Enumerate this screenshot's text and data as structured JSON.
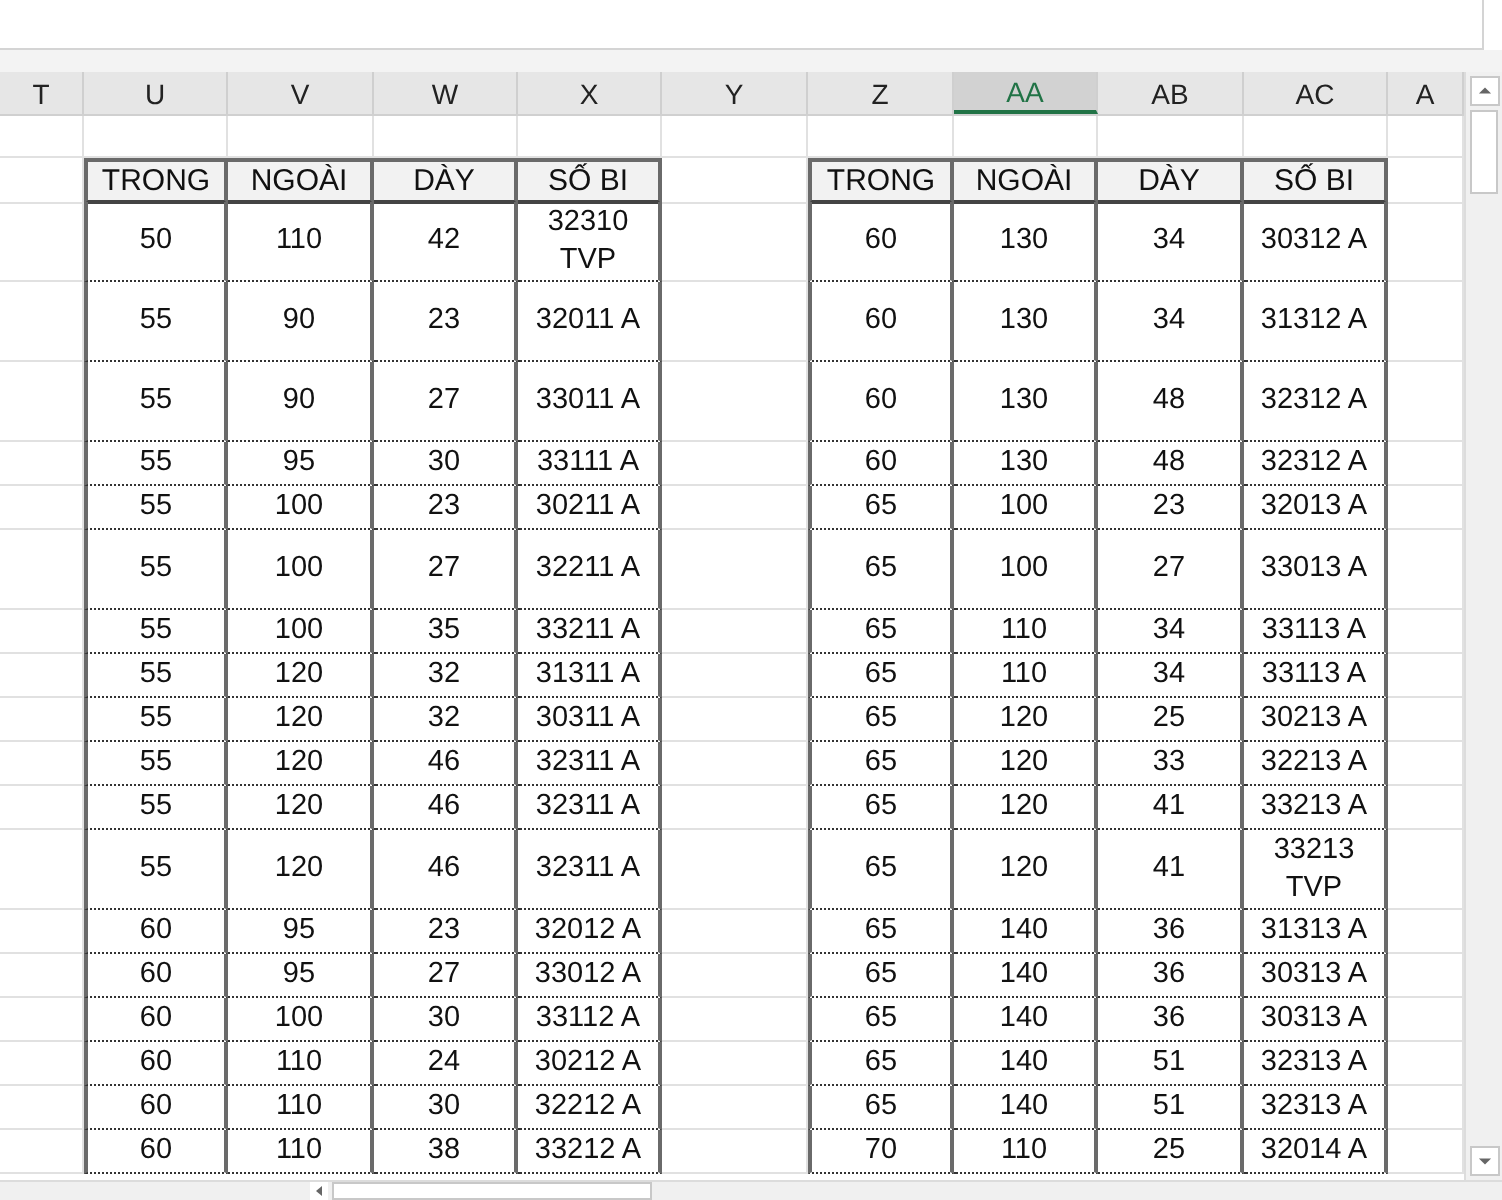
{
  "column_headers": [
    {
      "label": "T",
      "selected": false
    },
    {
      "label": "U",
      "selected": false
    },
    {
      "label": "V",
      "selected": false
    },
    {
      "label": "W",
      "selected": false
    },
    {
      "label": "X",
      "selected": false
    },
    {
      "label": "Y",
      "selected": false
    },
    {
      "label": "Z",
      "selected": false
    },
    {
      "label": "AA",
      "selected": true
    },
    {
      "label": "AB",
      "selected": false
    },
    {
      "label": "AC",
      "selected": false
    },
    {
      "label": "A",
      "selected": false
    }
  ],
  "tables": [
    {
      "columns": [
        "TRONG",
        "NGOÀI",
        "DÀY",
        "SỐ BI"
      ]
    },
    {
      "columns": [
        "TRONG",
        "NGOÀI",
        "DÀY",
        "SỐ BI"
      ]
    }
  ],
  "rows": [
    {
      "tall": true,
      "cells": [
        [
          "50",
          "110",
          "42",
          "32310 TVP"
        ],
        [
          "60",
          "130",
          "34",
          "30312 A"
        ]
      ]
    },
    {
      "tall": true,
      "cells": [
        [
          "55",
          "90",
          "23",
          "32011 A"
        ],
        [
          "60",
          "130",
          "34",
          "31312 A"
        ]
      ]
    },
    {
      "tall": true,
      "cells": [
        [
          "55",
          "90",
          "27",
          "33011 A"
        ],
        [
          "60",
          "130",
          "48",
          "32312 A"
        ]
      ]
    },
    {
      "tall": false,
      "cells": [
        [
          "55",
          "95",
          "30",
          "33111 A"
        ],
        [
          "60",
          "130",
          "48",
          "32312 A"
        ]
      ]
    },
    {
      "tall": false,
      "cells": [
        [
          "55",
          "100",
          "23",
          "30211 A"
        ],
        [
          "65",
          "100",
          "23",
          "32013 A"
        ]
      ]
    },
    {
      "tall": true,
      "cells": [
        [
          "55",
          "100",
          "27",
          "32211 A"
        ],
        [
          "65",
          "100",
          "27",
          "33013 A"
        ]
      ]
    },
    {
      "tall": false,
      "cells": [
        [
          "55",
          "100",
          "35",
          "33211 A"
        ],
        [
          "65",
          "110",
          "34",
          "33113 A"
        ]
      ]
    },
    {
      "tall": false,
      "cells": [
        [
          "55",
          "120",
          "32",
          "31311 A"
        ],
        [
          "65",
          "110",
          "34",
          "33113 A"
        ]
      ]
    },
    {
      "tall": false,
      "cells": [
        [
          "55",
          "120",
          "32",
          "30311 A"
        ],
        [
          "65",
          "120",
          "25",
          "30213 A"
        ]
      ]
    },
    {
      "tall": false,
      "cells": [
        [
          "55",
          "120",
          "46",
          "32311 A"
        ],
        [
          "65",
          "120",
          "33",
          "32213 A"
        ]
      ]
    },
    {
      "tall": false,
      "cells": [
        [
          "55",
          "120",
          "46",
          "32311 A"
        ],
        [
          "65",
          "120",
          "41",
          "33213 A"
        ]
      ]
    },
    {
      "tall": true,
      "cells": [
        [
          "55",
          "120",
          "46",
          "32311 A"
        ],
        [
          "65",
          "120",
          "41",
          "33213 TVP"
        ]
      ]
    },
    {
      "tall": false,
      "cells": [
        [
          "60",
          "95",
          "23",
          "32012 A"
        ],
        [
          "65",
          "140",
          "36",
          "31313 A"
        ]
      ]
    },
    {
      "tall": false,
      "cells": [
        [
          "60",
          "95",
          "27",
          "33012 A"
        ],
        [
          "65",
          "140",
          "36",
          "30313 A"
        ]
      ]
    },
    {
      "tall": false,
      "cells": [
        [
          "60",
          "100",
          "30",
          "33112 A"
        ],
        [
          "65",
          "140",
          "36",
          "30313 A"
        ]
      ]
    },
    {
      "tall": false,
      "cells": [
        [
          "60",
          "110",
          "24",
          "30212 A"
        ],
        [
          "65",
          "140",
          "51",
          "32313 A"
        ]
      ]
    },
    {
      "tall": false,
      "cells": [
        [
          "60",
          "110",
          "30",
          "32212 A"
        ],
        [
          "65",
          "140",
          "51",
          "32313 A"
        ]
      ]
    },
    {
      "tall": false,
      "cells": [
        [
          "60",
          "110",
          "38",
          "33212 A"
        ],
        [
          "70",
          "110",
          "25",
          "32014 A"
        ]
      ]
    }
  ]
}
